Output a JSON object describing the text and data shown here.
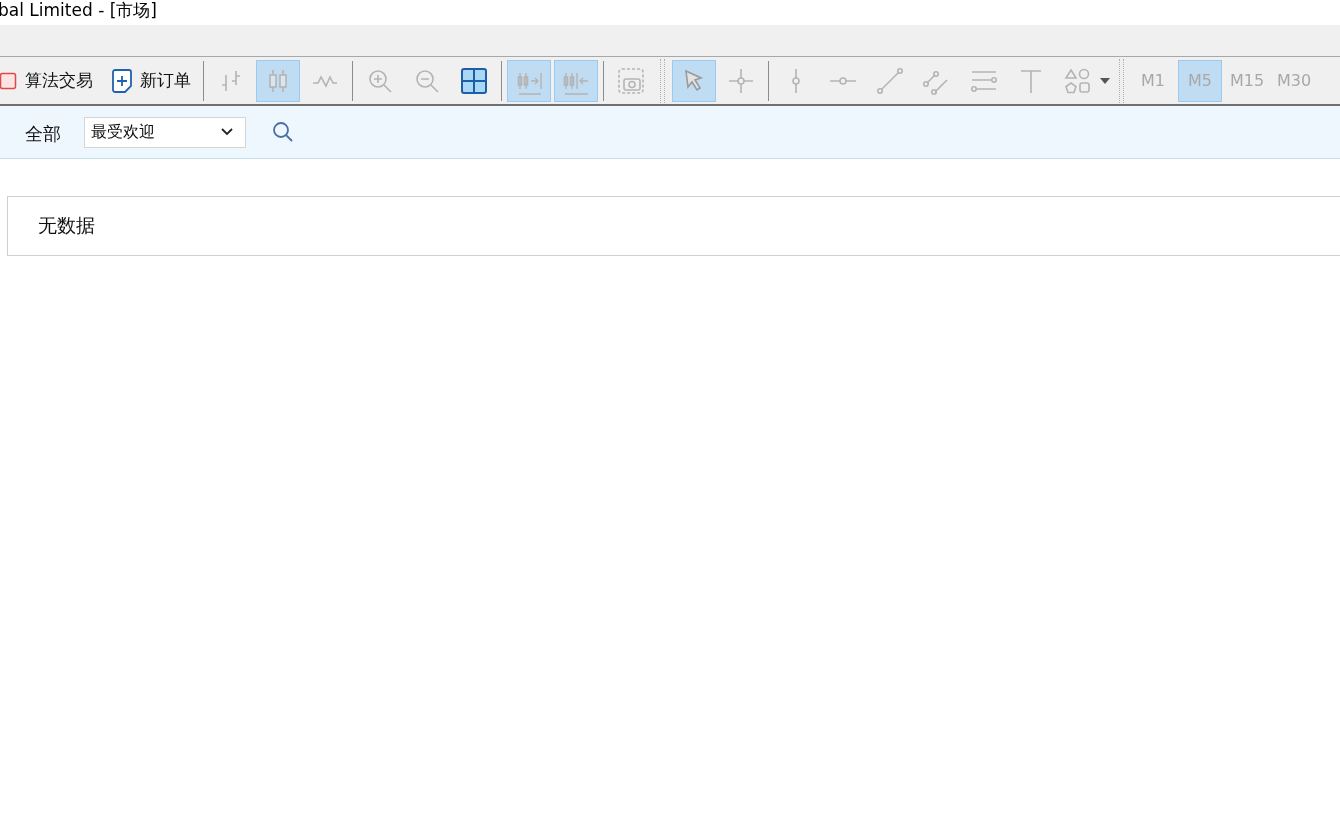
{
  "window": {
    "title": "bal Limited - [市场]"
  },
  "toolbar": [
    {
      "kind": "algo-trading",
      "label": "算法交易",
      "selected": false
    },
    {
      "kind": "new-order",
      "label": "新订单",
      "selected": false
    },
    {
      "kind": "separator"
    },
    {
      "kind": "bars",
      "selected": false
    },
    {
      "kind": "candles",
      "selected": true
    },
    {
      "kind": "line",
      "selected": false
    },
    {
      "kind": "separator"
    },
    {
      "kind": "zoom-in",
      "selected": false
    },
    {
      "kind": "zoom-out",
      "selected": false
    },
    {
      "kind": "tile",
      "selected": false
    },
    {
      "kind": "separator"
    },
    {
      "kind": "autoscroll",
      "selected": true
    },
    {
      "kind": "shift",
      "selected": true
    },
    {
      "kind": "separator"
    },
    {
      "kind": "screenshot",
      "selected": false
    },
    {
      "kind": "grip"
    },
    {
      "kind": "cursor",
      "selected": true
    },
    {
      "kind": "crosshair",
      "selected": false
    },
    {
      "kind": "separator"
    },
    {
      "kind": "vline",
      "selected": false
    },
    {
      "kind": "hline",
      "selected": false
    },
    {
      "kind": "trendline",
      "selected": false
    },
    {
      "kind": "channel",
      "selected": false
    },
    {
      "kind": "fibo",
      "selected": false
    },
    {
      "kind": "text",
      "selected": false
    },
    {
      "kind": "shapes",
      "selected": false
    },
    {
      "kind": "grip"
    },
    {
      "kind": "timeframe",
      "label": "M1",
      "selected": false
    },
    {
      "kind": "timeframe",
      "label": "M5",
      "selected": true
    },
    {
      "kind": "timeframe",
      "label": "M15",
      "selected": false
    },
    {
      "kind": "timeframe",
      "label": "M30",
      "selected": false
    }
  ],
  "filter": {
    "category": "全部",
    "sort": "最受欢迎"
  },
  "results": {
    "empty_message": "无数据"
  }
}
